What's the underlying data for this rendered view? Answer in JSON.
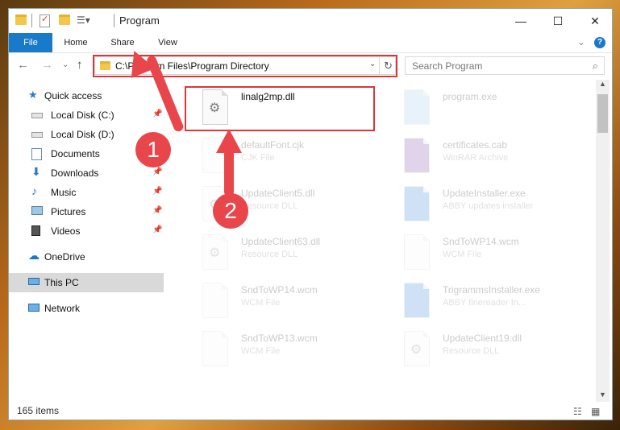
{
  "window": {
    "title": "Program",
    "minimize": "—",
    "maximize": "☐",
    "close": "✕"
  },
  "ribbon": {
    "tabs": [
      "File",
      "Home",
      "Share",
      "View"
    ],
    "expand": "⌄",
    "help": "?"
  },
  "address": {
    "path": "C:\\Program Files\\Program Directory",
    "dropdown": "⌄",
    "refresh": "↻"
  },
  "search": {
    "placeholder": "Search Program",
    "icon": "⌕"
  },
  "nav_icons": {
    "back": "←",
    "forward": "→",
    "recent": "⌄",
    "up": "↑"
  },
  "sidebar": {
    "quick_access": "Quick access",
    "items": [
      {
        "label": "Local Disk (C:)",
        "icon": "drive-icon",
        "pin": "📌"
      },
      {
        "label": "Local Disk (D:)",
        "icon": "drive-icon",
        "pin": ""
      },
      {
        "label": "Documents",
        "icon": "documents-icon",
        "pin": "📌"
      },
      {
        "label": "Downloads",
        "icon": "downloads-icon",
        "pin": "📌"
      },
      {
        "label": "Music",
        "icon": "music-icon",
        "pin": "📌"
      },
      {
        "label": "Pictures",
        "icon": "pictures-icon",
        "pin": "📌"
      },
      {
        "label": "Videos",
        "icon": "videos-icon",
        "pin": "📌"
      }
    ],
    "onedrive": "OneDrive",
    "thispc": "This PC",
    "network": "Network"
  },
  "files": [
    {
      "name": "linalg2mp.dll",
      "type": "",
      "icon": "dll-gear-icon",
      "faded": false
    },
    {
      "name": "program.exe",
      "type": "",
      "icon": "exe-icon",
      "faded": true
    },
    {
      "name": "defaultFont.cjk",
      "type": "CJK File",
      "icon": "file-icon",
      "faded": true
    },
    {
      "name": "certificates.cab",
      "type": "WinRAR Archive",
      "icon": "archive-icon",
      "faded": true
    },
    {
      "name": "UpdateClient5.dll",
      "type": "Resource DLL",
      "icon": "dll-icon",
      "faded": true
    },
    {
      "name": "UpdateInstaller.exe",
      "type": "ABBY updates installer",
      "icon": "installer-icon",
      "faded": true
    },
    {
      "name": "UpdateClient63.dll",
      "type": "Resource DLL",
      "icon": "dll-icon",
      "faded": true
    },
    {
      "name": "SndToWP14.wcm",
      "type": "WCM File",
      "icon": "file-icon",
      "faded": true
    },
    {
      "name": "SndToWP14.wcm",
      "type": "WCM File",
      "icon": "file-icon",
      "faded": true
    },
    {
      "name": "TrigrammsInstaller.exe",
      "type": "ABBY finereader In...",
      "icon": "installer-icon",
      "faded": true
    },
    {
      "name": "SndToWP13.wcm",
      "type": "WCM File",
      "icon": "file-icon",
      "faded": true
    },
    {
      "name": "UpdateClient19.dll",
      "type": "Resource DLL",
      "icon": "dll-icon",
      "faded": true
    }
  ],
  "status": {
    "count": "165 items"
  },
  "steps": {
    "one": "1",
    "two": "2"
  },
  "colors": {
    "accent": "#1979ca",
    "highlight": "#d9383a",
    "arrow": "#e8464b"
  }
}
